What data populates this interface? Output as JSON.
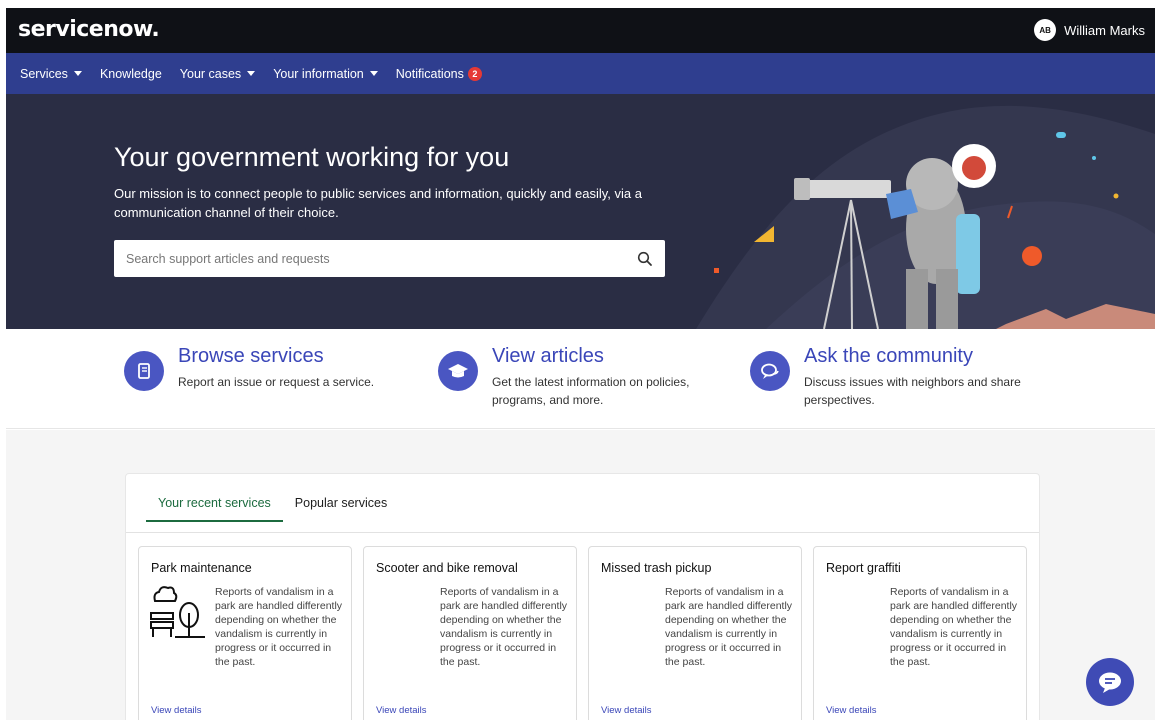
{
  "header": {
    "logo_text": "servicenow.",
    "user_initials": "AB",
    "user_name": "William Marks"
  },
  "nav": {
    "items": [
      {
        "label": "Services",
        "has_caret": true
      },
      {
        "label": "Knowledge",
        "has_caret": false
      },
      {
        "label": "Your cases",
        "has_caret": true
      },
      {
        "label": "Your information",
        "has_caret": true
      },
      {
        "label": "Notifications",
        "has_caret": false
      }
    ],
    "notifications_count": "2"
  },
  "hero": {
    "title": "Your government working for you",
    "subtitle": "Our mission is to connect people to public services and information, quickly and easily, via a communication channel of their choice.",
    "search_placeholder": "Search support articles and requests"
  },
  "features": [
    {
      "title": "Browse services",
      "desc": "Report an issue or request a service.",
      "icon": "book-icon"
    },
    {
      "title": "View articles",
      "desc": "Get the latest information on policies, programs, and more.",
      "icon": "graduation-cap-icon"
    },
    {
      "title": "Ask the community",
      "desc": "Discuss issues with neighbors and share perspectives.",
      "icon": "chat-bubbles-icon"
    }
  ],
  "services": {
    "tabs": [
      "Your recent services",
      "Popular services"
    ],
    "active_tab": 0,
    "cards": [
      {
        "title": "Park maintenance",
        "desc": "Reports of vandalism in a park are handled differently depending on whether the vandalism is currently in progress or it occurred in the past.",
        "link": "View details"
      },
      {
        "title": "Scooter and bike removal",
        "desc": "Reports of vandalism in a park are handled differently depending on whether the vandalism is currently in progress or it occurred in the past.",
        "link": "View details"
      },
      {
        "title": "Missed trash pickup",
        "desc": "Reports of vandalism in a park are handled differently depending on whether the vandalism is currently in progress or it occurred in the past.",
        "link": "View details"
      },
      {
        "title": "Report graffiti",
        "desc": "Reports of vandalism in a park are handled differently depending on whether the vandalism is currently in progress or it occurred in the past.",
        "link": "View details"
      }
    ]
  },
  "colors": {
    "topbar": "#0f1116",
    "nav": "#2f3e8f",
    "hero": "#2a2d44",
    "accent": "#3a46b8",
    "tab_active": "#1c6b3f"
  }
}
